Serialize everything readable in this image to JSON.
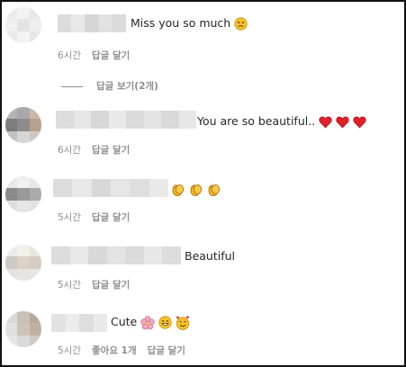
{
  "comments": [
    {
      "text": "Miss you so much",
      "emoji": [
        "sad-face"
      ],
      "time": "6시간",
      "reply_label": "답글 달기"
    },
    {
      "view_replies": "답글 보기(2개)"
    },
    {
      "text": "You are so beautiful..",
      "emoji": [
        "red-heart",
        "red-heart",
        "red-heart"
      ],
      "time": "6시간",
      "reply_label": "답글 달기"
    },
    {
      "text": "",
      "emoji": [
        "clapping-hands",
        "clapping-hands",
        "clapping-hands"
      ],
      "time": "5시간",
      "reply_label": "답글 달기"
    },
    {
      "text": "Beautiful",
      "emoji": [],
      "time": "5시간",
      "reply_label": "답글 달기"
    },
    {
      "text": "Cute",
      "emoji": [
        "cherry-blossom",
        "grinning-face",
        "smiling-face-with-hearts"
      ],
      "time": "5시간",
      "likes": "좋아요 1개",
      "reply_label": "답글 달기"
    }
  ],
  "colors": {
    "primary_text": "#262626",
    "secondary_text": "#8e8e8e",
    "border": "#111111"
  }
}
